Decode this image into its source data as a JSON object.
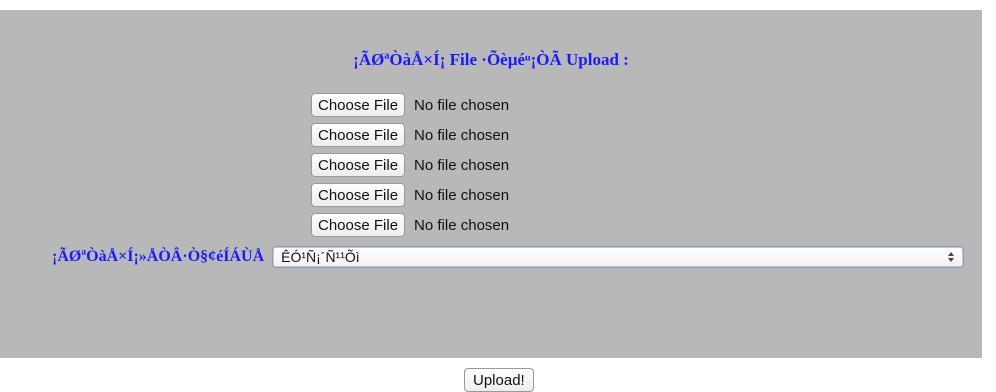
{
  "form": {
    "heading": "¡ÃØªÒàÅ×Í¡ File ·Õèµéͧ¡ÒÃ Upload :",
    "files": [
      {
        "button_label": "Choose File",
        "status": "No file chosen"
      },
      {
        "button_label": "Choose File",
        "status": "No file chosen"
      },
      {
        "button_label": "Choose File",
        "status": "No file chosen"
      },
      {
        "button_label": "Choose File",
        "status": "No file chosen"
      },
      {
        "button_label": "Choose File",
        "status": "No file chosen"
      }
    ],
    "select_label": "¡ÃØªÒàÅ×Í¡»ÅÒÂ·Ò§¢éÍÁÙÅ",
    "select_value": "ÊÓ¹Ñ¡´Ñ¹¹Õì",
    "submit_label": "Upload!"
  },
  "colors": {
    "panel_background": "#b8b8b8",
    "heading_text": "#1a1aff"
  }
}
